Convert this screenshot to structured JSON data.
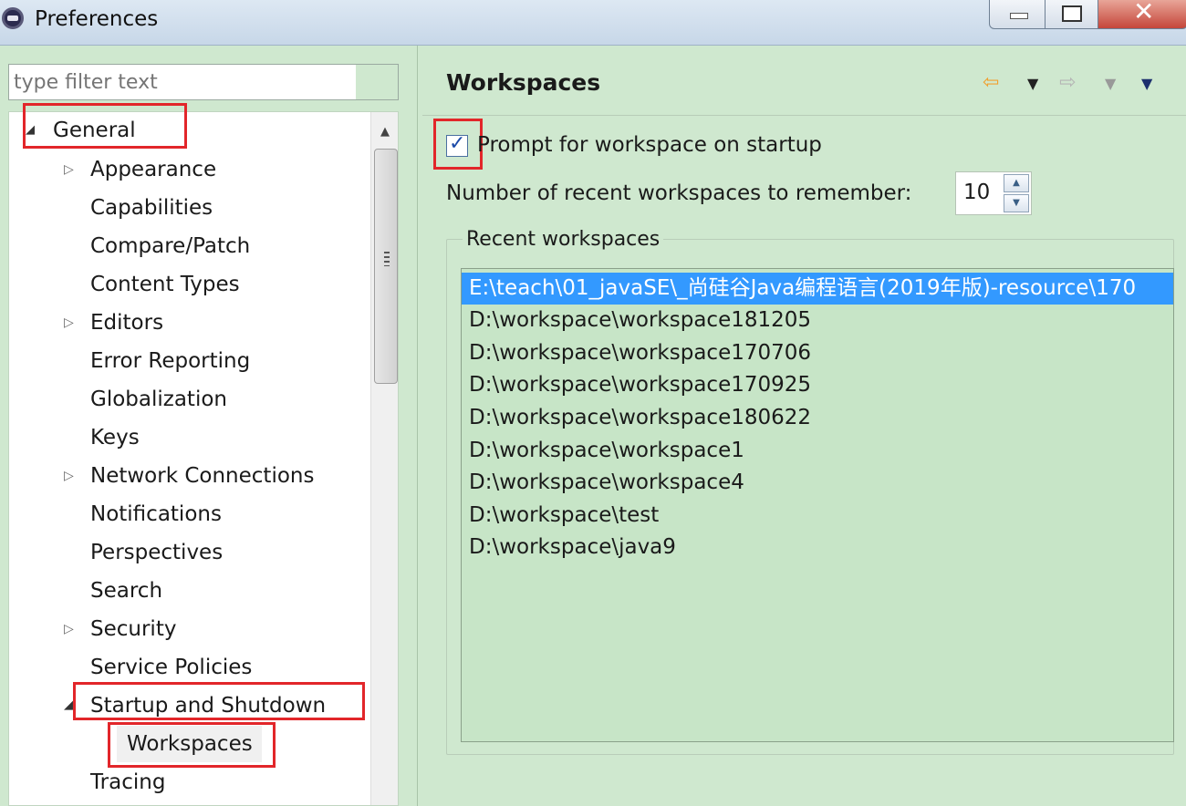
{
  "window": {
    "title": "Preferences"
  },
  "filter": {
    "placeholder": "type filter text"
  },
  "tree": {
    "items": [
      {
        "label": "General",
        "expanded": true
      },
      {
        "label": "Appearance",
        "expandable": true
      },
      {
        "label": "Capabilities"
      },
      {
        "label": "Compare/Patch"
      },
      {
        "label": "Content Types"
      },
      {
        "label": "Editors",
        "expandable": true
      },
      {
        "label": "Error Reporting"
      },
      {
        "label": "Globalization"
      },
      {
        "label": "Keys"
      },
      {
        "label": "Network Connections",
        "expandable": true
      },
      {
        "label": "Notifications"
      },
      {
        "label": "Perspectives"
      },
      {
        "label": "Search"
      },
      {
        "label": "Security",
        "expandable": true
      },
      {
        "label": "Service Policies"
      },
      {
        "label": "Startup and Shutdown",
        "expanded": true
      },
      {
        "label": "Workspaces",
        "selected": true
      },
      {
        "label": "Tracing"
      }
    ]
  },
  "page": {
    "title": "Workspaces",
    "prompt_checkbox": {
      "label": "Prompt for workspace on startup",
      "checked": true
    },
    "recent_count": {
      "label": "Number of recent workspaces to remember:",
      "value": "10"
    },
    "recent_group_label": "Recent workspaces",
    "recent_workspaces": [
      "E:\\teach\\01_javaSE\\_尚硅谷Java编程语言(2019年版)-resource\\170",
      "D:\\workspace\\workspace181205",
      "D:\\workspace\\workspace170706",
      "D:\\workspace\\workspace170925",
      "D:\\workspace\\workspace180622",
      "D:\\workspace\\workspace1",
      "D:\\workspace\\workspace4",
      "D:\\workspace\\test",
      "D:\\workspace\\java9"
    ]
  },
  "colors": {
    "highlight_box": "#e2262a",
    "selection": "#3399ff",
    "panel_bg": "#cfe8cf",
    "back_arrow": "#f0a030"
  }
}
